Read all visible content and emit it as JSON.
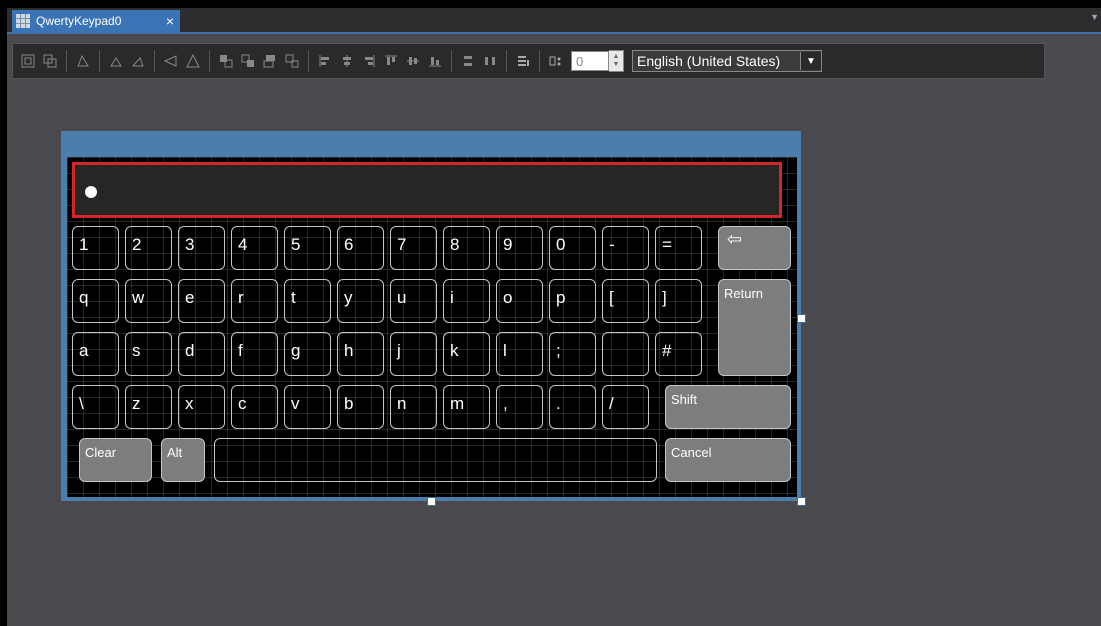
{
  "tab": {
    "title": "QwertyKeypad0",
    "close": "×"
  },
  "toolbar": {
    "spin_value": "0",
    "language": "English (United States)"
  },
  "keypad": {
    "display_text": "",
    "rows": [
      [
        "1",
        "2",
        "3",
        "4",
        "5",
        "6",
        "7",
        "8",
        "9",
        "0",
        "-",
        "="
      ],
      [
        "q",
        "w",
        "e",
        "r",
        "t",
        "y",
        "u",
        "i",
        "o",
        "p",
        "[",
        "]"
      ],
      [
        "a",
        "s",
        "d",
        "f",
        "g",
        "h",
        "j",
        "k",
        "l",
        ";",
        "",
        "#"
      ],
      [
        "\\",
        "z",
        "x",
        "c",
        "v",
        "b",
        "n",
        "m",
        ",",
        ".",
        "/"
      ]
    ],
    "backspace": "⇦",
    "return": "Return",
    "shift": "Shift",
    "clear": "Clear",
    "alt": "Alt",
    "space": "",
    "cancel": "Cancel"
  }
}
